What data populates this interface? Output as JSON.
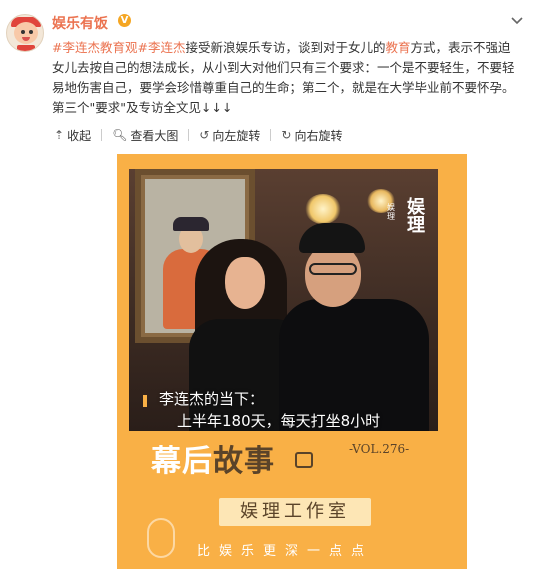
{
  "user": {
    "name": "娱乐有饭",
    "verified_badge": "V"
  },
  "post": {
    "tag1": "#李连杰教育观#",
    "mention": "李连杰",
    "text_a": "接受新浪娱乐专访，谈到对于女儿的",
    "keyword": "教育",
    "text_b": "方式，表示不强迫女儿去按自己的想法成长，从小到大对他们只有三个要求：一个是不要轻生，不要轻易地伤害自己，要学会珍惜尊重自己的生命；第二个，就是在大学毕业前不要怀孕。第三个\"要求\"及专访全文见↓↓↓"
  },
  "toolbar": {
    "collapse": "收起",
    "view_large": "查看大图",
    "rotate_left": "向左旋转",
    "rotate_right": "向右旋转"
  },
  "poster": {
    "brand_big": "娱理",
    "brand_small": "娱理",
    "caption_line1": "李连杰的当下：",
    "caption_line2": "上半年180天，每天打坐8小时",
    "story_light": "幕后",
    "story_dark": "故事",
    "vol": "-VOL.276-",
    "studio": "娱理工作室",
    "slogan": "比娱乐更深一点点"
  },
  "colors": {
    "accent": "#eb7350",
    "poster_bg": "#f9b046",
    "dark_brown": "#5a4329"
  },
  "icons": {
    "verified": "verified-badge-icon",
    "menu": "chevron-down-icon",
    "collapse": "arrow-up-icon",
    "zoom": "magnifier-icon",
    "rotate_left": "rotate-left-icon",
    "rotate_right": "rotate-right-icon"
  }
}
